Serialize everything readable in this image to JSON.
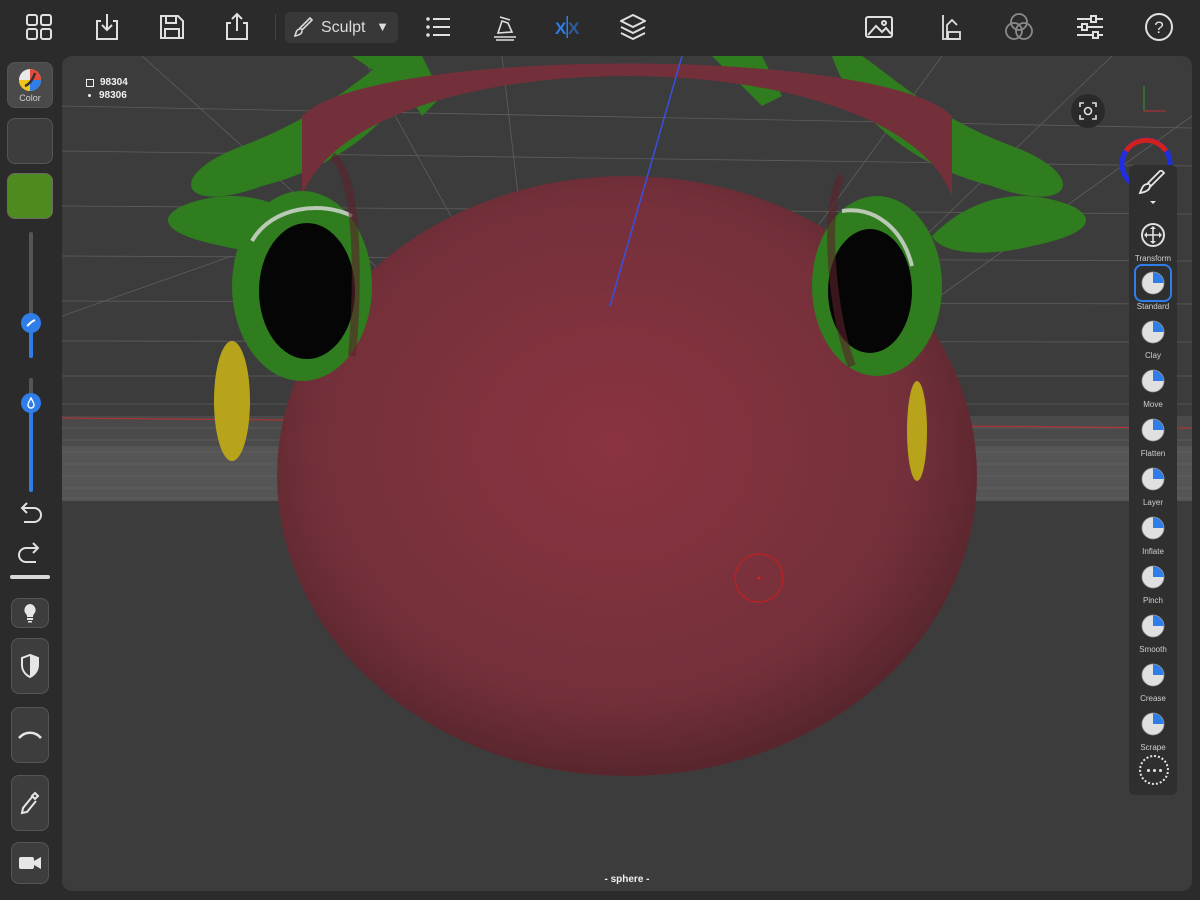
{
  "topbar": {
    "mode_label": "Sculpt",
    "icons": [
      "grid-icon",
      "import-icon",
      "save-icon",
      "share-icon",
      "list-icon",
      "hand-tool-icon",
      "symmetry-icon",
      "layers-icon",
      "image-icon",
      "material-icon",
      "blend-icon",
      "sliders-icon",
      "help-icon"
    ]
  },
  "viewport": {
    "stats": {
      "faces": "98304",
      "vertices": "98306"
    },
    "mesh_name": "- sphere -"
  },
  "left": {
    "color_label": "Color",
    "color_swatch": "#4f8a1e",
    "radius_fraction": 0.28,
    "intensity_fraction": 0.78
  },
  "tools": [
    {
      "label": "Transform",
      "name": "transform"
    },
    {
      "label": "Standard",
      "name": "standard",
      "active": true
    },
    {
      "label": "Clay",
      "name": "clay"
    },
    {
      "label": "Move",
      "name": "move"
    },
    {
      "label": "Flatten",
      "name": "flatten"
    },
    {
      "label": "Layer",
      "name": "layer"
    },
    {
      "label": "Inflate",
      "name": "inflate"
    },
    {
      "label": "Pinch",
      "name": "pinch"
    },
    {
      "label": "Smooth",
      "name": "smooth"
    },
    {
      "label": "Crease",
      "name": "crease"
    },
    {
      "label": "Scrape",
      "name": "scrape"
    }
  ],
  "colors": {
    "accent": "#2e7de8",
    "head": "#7a2e36",
    "leaf": "#2f7d1e",
    "spot": "#b8a41a"
  }
}
